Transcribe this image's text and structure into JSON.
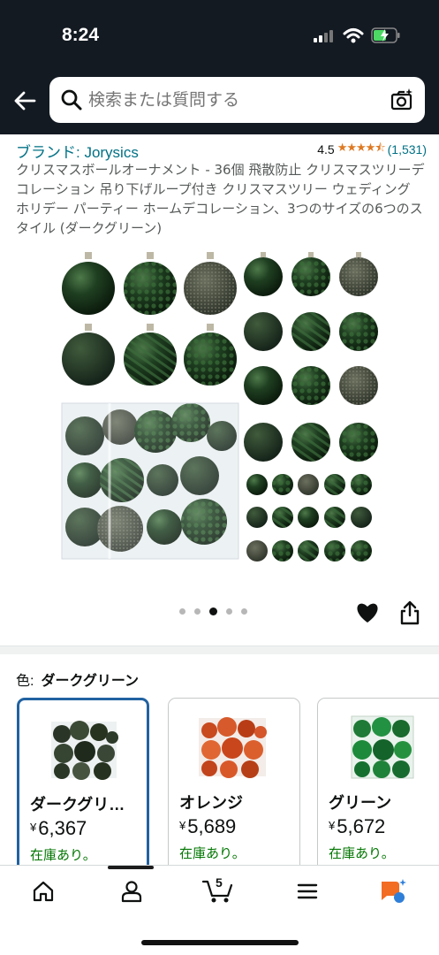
{
  "status": {
    "time": "8:24"
  },
  "search": {
    "placeholder": "検索または質問する"
  },
  "product": {
    "brand": "ブランド: Jorysics",
    "rating_value": "4.5",
    "rating_count": "(1,531)",
    "title": "クリスマスボールオーナメント - 36個 飛散防止 クリスマスツリーデコレーション 吊り下げループ付き クリスマスツリー ウェディング ホリデー パーティー ホームデコレーション、3つのサイズの6つのスタイル (ダークグリーン)",
    "image_count": 5,
    "image_index": 3
  },
  "variant": {
    "label": "色:",
    "selected": "ダークグリーン",
    "options": [
      {
        "name": "ダークグリ…",
        "currency": "¥",
        "price": "6,367",
        "stock": "在庫あり。",
        "color": "#2f3d2a",
        "selected": true
      },
      {
        "name": "オレンジ",
        "currency": "¥",
        "price": "5,689",
        "stock": "在庫あり。",
        "color": "#c8461f",
        "selected": false
      },
      {
        "name": "グリーン",
        "currency": "¥",
        "price": "5,672",
        "stock": "在庫あり。",
        "color": "#1d7a35",
        "selected": false
      }
    ]
  },
  "nav": {
    "cart_count": "5",
    "items": [
      "home-icon",
      "account-icon",
      "cart-icon",
      "menu-icon",
      "ai-assistant-icon"
    ]
  },
  "colors": {
    "header_bg": "#131a22",
    "link": "#007185",
    "star": "#de7921",
    "stock": "#007600",
    "selected_border": "#2162a1"
  }
}
